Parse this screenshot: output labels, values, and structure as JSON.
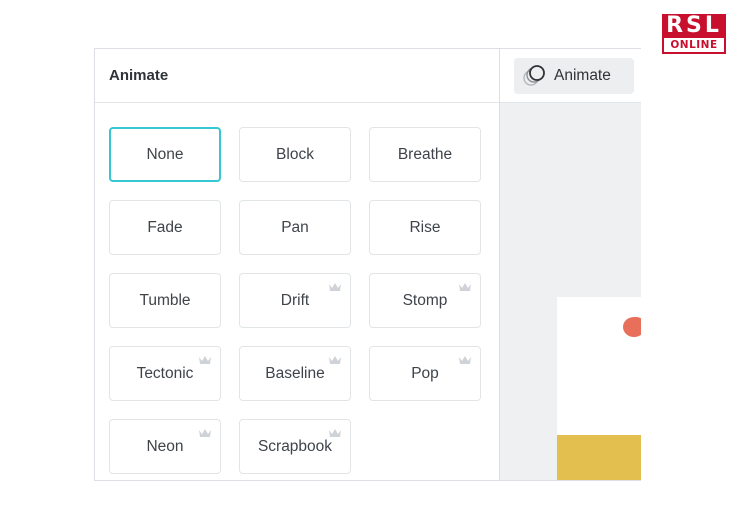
{
  "watermark": {
    "line1": "RSL",
    "line2": "ONLINE"
  },
  "panel": {
    "title": "Animate",
    "options": [
      {
        "label": "None",
        "selected": true,
        "premium": false
      },
      {
        "label": "Block",
        "selected": false,
        "premium": false
      },
      {
        "label": "Breathe",
        "selected": false,
        "premium": false
      },
      {
        "label": "Fade",
        "selected": false,
        "premium": false
      },
      {
        "label": "Pan",
        "selected": false,
        "premium": false
      },
      {
        "label": "Rise",
        "selected": false,
        "premium": false
      },
      {
        "label": "Tumble",
        "selected": false,
        "premium": false
      },
      {
        "label": "Drift",
        "selected": false,
        "premium": true
      },
      {
        "label": "Stomp",
        "selected": false,
        "premium": true
      },
      {
        "label": "Tectonic",
        "selected": false,
        "premium": true
      },
      {
        "label": "Baseline",
        "selected": false,
        "premium": true
      },
      {
        "label": "Pop",
        "selected": false,
        "premium": true
      },
      {
        "label": "Neon",
        "selected": false,
        "premium": true
      },
      {
        "label": "Scrapbook",
        "selected": false,
        "premium": true
      }
    ]
  },
  "toolbar": {
    "animate_label": "Animate"
  },
  "colors": {
    "selected_border": "#35c7d3",
    "crown": "#cfd3d7",
    "ground": "#e2bf4e",
    "blob": "#e8705b"
  }
}
